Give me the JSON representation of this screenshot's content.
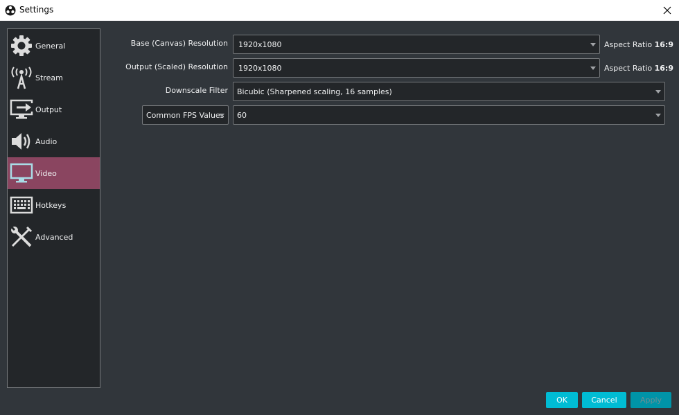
{
  "window": {
    "title": "Settings",
    "icon": "obs-logo-icon",
    "close_icon": "close-icon"
  },
  "sidebar": {
    "items": [
      {
        "label": "General",
        "icon": "gear-icon",
        "active": false
      },
      {
        "label": "Stream",
        "icon": "broadcast-antenna-icon",
        "active": false
      },
      {
        "label": "Output",
        "icon": "output-monitor-arrow-icon",
        "active": false
      },
      {
        "label": "Audio",
        "icon": "speaker-icon",
        "active": false
      },
      {
        "label": "Video",
        "icon": "monitor-icon",
        "active": true
      },
      {
        "label": "Hotkeys",
        "icon": "keyboard-icon",
        "active": false
      },
      {
        "label": "Advanced",
        "icon": "tools-icon",
        "active": false
      }
    ]
  },
  "video": {
    "base_resolution": {
      "label": "Base (Canvas) Resolution",
      "value": "1920x1080",
      "aspect_label": "Aspect Ratio",
      "aspect_value": "16:9"
    },
    "output_resolution": {
      "label": "Output (Scaled) Resolution",
      "value": "1920x1080",
      "aspect_label": "Aspect Ratio",
      "aspect_value": "16:9"
    },
    "downscale_filter": {
      "label": "Downscale Filter",
      "value": "Bicubic (Sharpened scaling, 16 samples)"
    },
    "fps": {
      "type_value": "Common FPS Values",
      "value": "60"
    }
  },
  "buttons": {
    "ok": "OK",
    "cancel": "Cancel",
    "apply": "Apply"
  },
  "colors": {
    "accent": "#00bcd4",
    "active_nav": "#8a4560",
    "background": "#31363b",
    "panel": "#232629"
  }
}
